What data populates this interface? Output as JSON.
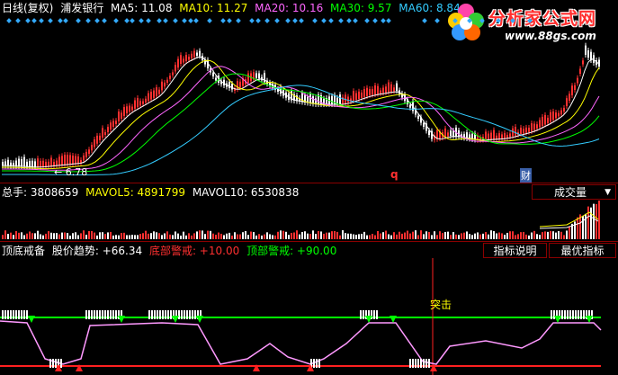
{
  "price_header": {
    "title": "日线(复权)",
    "stock": "浦发银行",
    "ma5": "MA5: 11.08",
    "ma10": "MA10: 11.27",
    "ma20": "MA20: 10.16",
    "ma30": "MA30: 9.57",
    "ma60": "MA60: 8.84"
  },
  "price_panel": {
    "low_label": "← 6.78",
    "marker_q": "q",
    "marker_cai": "财"
  },
  "volume_header": {
    "total": "总手: 3808659",
    "mavol5": "MAVOL5: 4891799",
    "mavol10": "MAVOL10: 6530838"
  },
  "volume_panel": {
    "selector": "成交量",
    "selector_icon": "chevron-down-icon"
  },
  "indicator_header": {
    "name": "顶底戒备",
    "trend": "股价趋势: +66.34",
    "bottom_warning": "底部警戒: +10.00",
    "top_warning": "顶部警戒: +90.00"
  },
  "indicator_panel": {
    "btn_explain": "指标说明",
    "btn_optimize": "最优指标",
    "breakout_label": "突击"
  },
  "logo": {
    "text": "分析家公式网",
    "url": "www.88gs.com"
  },
  "colors": {
    "ma5": "#ffffff",
    "ma10": "#ffff00",
    "ma20": "#ff66ff",
    "ma30": "#00ff00",
    "ma60": "#33ccff",
    "up": "#ff3030",
    "down": "#ffffff",
    "top_line": "#00ff00",
    "bottom_line": "#ff2020",
    "curve": "#ff99ff"
  }
}
